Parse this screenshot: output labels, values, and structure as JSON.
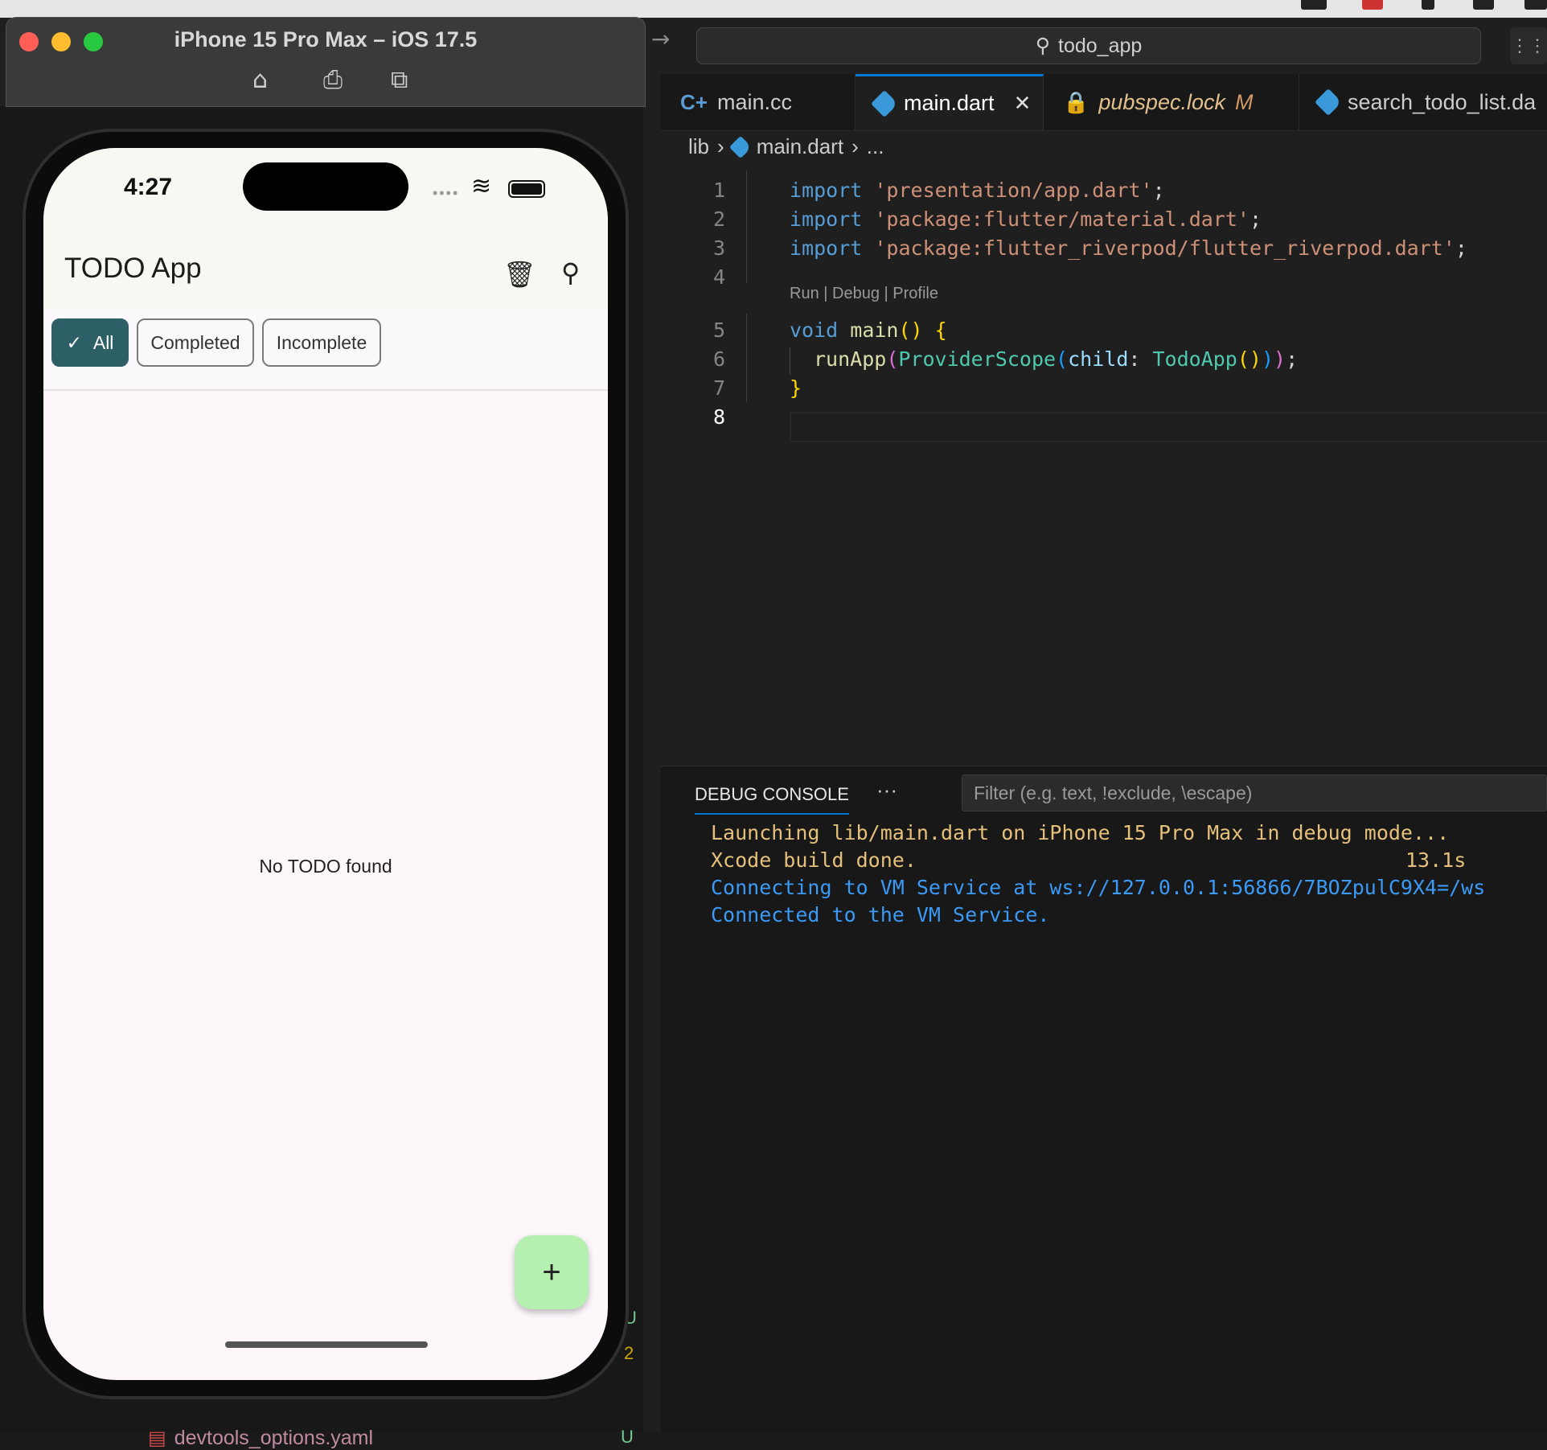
{
  "simulator": {
    "title": "iPhone 15 Pro Max – iOS 17.5",
    "toolbar_icons": [
      "home-icon",
      "screenshot-icon",
      "rotate-icon"
    ]
  },
  "phone": {
    "time": "4:27",
    "signal": "••••",
    "app_title": "TODO App",
    "filters": [
      {
        "label": "All",
        "selected": true
      },
      {
        "label": "Completed",
        "selected": false
      },
      {
        "label": "Incomplete",
        "selected": false
      }
    ],
    "empty_message": "No TODO found",
    "fab_label": "+"
  },
  "editor": {
    "search_text": "todo_app",
    "tabs": [
      {
        "label": "main.cc",
        "icon": "cpp-icon"
      },
      {
        "label": "main.dart",
        "icon": "dart-icon",
        "active": true
      },
      {
        "label": "pubspec.lock",
        "icon": "lock-icon",
        "status": "M"
      },
      {
        "label": "search_todo_list.da",
        "icon": "dart-icon"
      }
    ],
    "breadcrumb": [
      "lib",
      "main.dart",
      "..."
    ],
    "codelens": [
      "Run",
      "Debug",
      "Profile"
    ],
    "line_numbers": [
      "1",
      "2",
      "3",
      "4",
      "5",
      "6",
      "7",
      "8"
    ],
    "code": {
      "l1": [
        "import",
        "'presentation/app.dart'",
        ";"
      ],
      "l2": [
        "import",
        "'package:flutter/material.dart'",
        ";"
      ],
      "l3": [
        "import",
        "'package:flutter_riverpod/flutter_riverpod.dart'",
        ";"
      ],
      "l5": [
        "void",
        "main",
        "()",
        "{"
      ],
      "l6": [
        "runApp",
        "(",
        "ProviderScope",
        "(",
        "child",
        ":",
        "TodoApp",
        "()",
        ")",
        ")",
        ";"
      ],
      "l7": [
        "}"
      ]
    }
  },
  "debug_console": {
    "tab_label": "DEBUG CONSOLE",
    "more": "···",
    "filter_placeholder": "Filter (e.g. text, !exclude, \\escape)",
    "lines": [
      "Launching lib/main.dart on iPhone 15 Pro Max in debug mode...",
      "Xcode build done.",
      "Connecting to VM Service at ws://127.0.0.1:56866/7BOZpulC9X4=/ws",
      "Connected to the VM Service."
    ],
    "build_time": "13.1s"
  },
  "explorer": {
    "file": "devtools_options.yaml",
    "file_status": "U",
    "stray_markers": [
      "U",
      "2"
    ]
  },
  "colors": {
    "accent_blue": "#0078d4",
    "chip_selected": "#2d5f66",
    "fab": "#b6f0b0",
    "console_yellow": "#e5c07b",
    "console_blue": "#3b9af5"
  }
}
